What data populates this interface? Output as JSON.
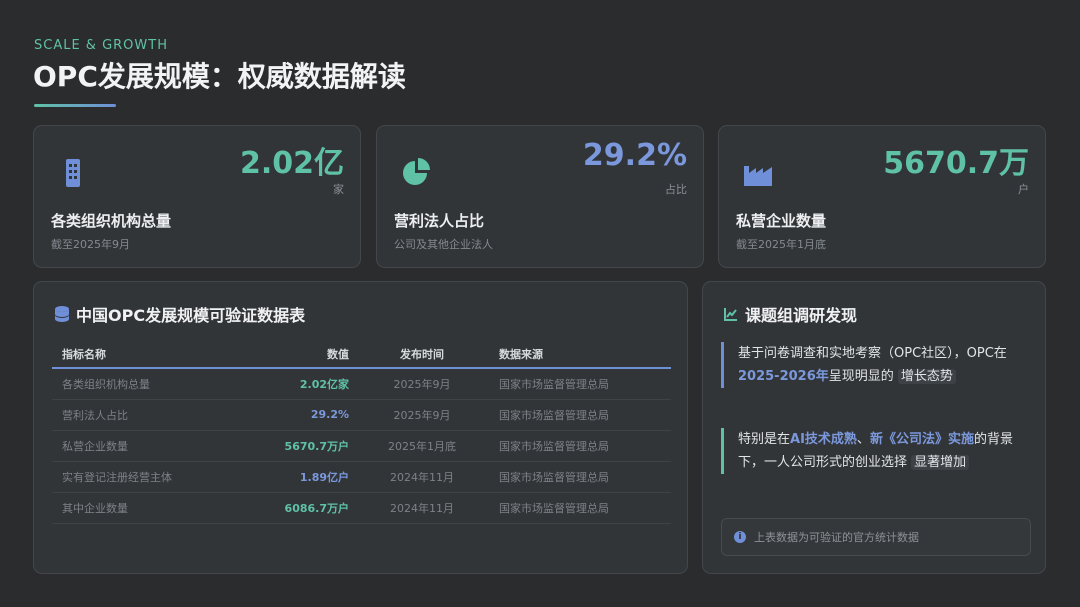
{
  "header": {
    "kicker": "SCALE & GROWTH",
    "title": "OPC发展规模：权威数据解读"
  },
  "stats": [
    {
      "icon": "building-icon",
      "value": "2.02亿",
      "unit": "家",
      "label": "各类组织机构总量",
      "note": "截至2025年9月",
      "color": "#5fc2a6"
    },
    {
      "icon": "pie-chart-icon",
      "value": "29.2%",
      "unit": "占比",
      "label": "营利法人占比",
      "note": "公司及其他企业法人",
      "color": "#7b98dc"
    },
    {
      "icon": "factory-icon",
      "value": "5670.7万",
      "unit": "户",
      "label": "私营企业数量",
      "note": "截至2025年1月底",
      "color": "#5fc2a6"
    }
  ],
  "table_section": {
    "title": "中国OPC发展规模可验证数据表",
    "columns": [
      "指标名称",
      "数值",
      "发布时间",
      "数据来源"
    ],
    "rows": [
      [
        "各类组织机构总量",
        "2.02亿家",
        "2025年9月",
        "国家市场监督管理总局"
      ],
      [
        "营利法人占比",
        "29.2%",
        "2025年9月",
        "国家市场监督管理总局"
      ],
      [
        "私营企业数量",
        "5670.7万户",
        "2025年1月底",
        "国家市场监督管理总局"
      ],
      [
        "实有登记注册经营主体",
        "1.89亿户",
        "2024年11月",
        "国家市场监督管理总局"
      ],
      [
        "其中企业数量",
        "6086.7万户",
        "2024年11月",
        "国家市场监督管理总局"
      ]
    ],
    "value_colors": [
      "#5fc2a6",
      "#7b98dc",
      "#5fc2a6",
      "#7b98dc",
      "#5fc2a6"
    ]
  },
  "findings": {
    "title": "课题组调研发现",
    "f1": {
      "part1": "基于问卷调查和实地考察（OPC社区），OPC在",
      "hl1": "2025-2026年",
      "part2": "呈现明显的",
      "chip": "增长态势"
    },
    "f2": {
      "part1": "特别是在",
      "hl1": "AI技术成熟",
      "part2": "、",
      "hl2": "新《公司法》实施",
      "part3": "的背景下，一人公司形式的创业选择",
      "chip": "显著增加"
    },
    "footnote": "上表数据为可验证的官方统计数据"
  }
}
